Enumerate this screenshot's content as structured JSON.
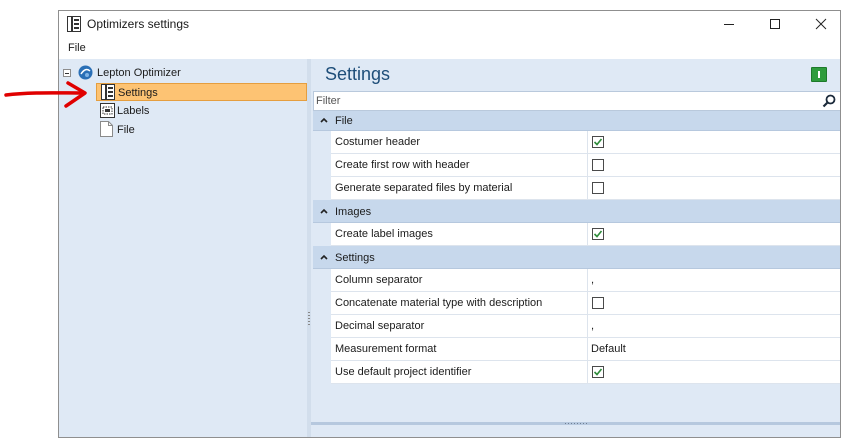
{
  "window": {
    "title": "Optimizers settings"
  },
  "menu": {
    "file_label": "File"
  },
  "tree": {
    "root_label": "Lepton Optimizer",
    "items": [
      {
        "label": "Settings",
        "icon": "settings-page-icon",
        "selected": true
      },
      {
        "label": "Labels",
        "icon": "labels-page-icon",
        "selected": false
      },
      {
        "label": "File",
        "icon": "file-page-icon",
        "selected": false
      }
    ]
  },
  "panel": {
    "heading": "Settings",
    "filter_placeholder": "Filter"
  },
  "properties": {
    "categories": [
      {
        "label": "File",
        "rows": [
          {
            "name": "Costumer header",
            "type": "checkbox",
            "checked": true
          },
          {
            "name": "Create first row with header",
            "type": "checkbox",
            "checked": false
          },
          {
            "name": "Generate separated files by material",
            "type": "checkbox",
            "checked": false
          }
        ]
      },
      {
        "label": "Images",
        "rows": [
          {
            "name": "Create label images",
            "type": "checkbox",
            "checked": true
          }
        ]
      },
      {
        "label": "Settings",
        "rows": [
          {
            "name": "Column separator",
            "type": "text",
            "value": ","
          },
          {
            "name": "Concatenate material type with description",
            "type": "checkbox",
            "checked": false
          },
          {
            "name": "Decimal separator",
            "type": "text",
            "value": ","
          },
          {
            "name": "Measurement format",
            "type": "text",
            "value": "Default"
          },
          {
            "name": "Use default project identifier",
            "type": "checkbox",
            "checked": true
          }
        ]
      }
    ]
  },
  "colors": {
    "selection": "#fdc373",
    "panel_background": "#dfe9f5",
    "category_background": "#c7d8ec",
    "heading": "#1e4e79",
    "annotation_arrow": "#e00000",
    "check_mark": "#2e8b3a"
  }
}
